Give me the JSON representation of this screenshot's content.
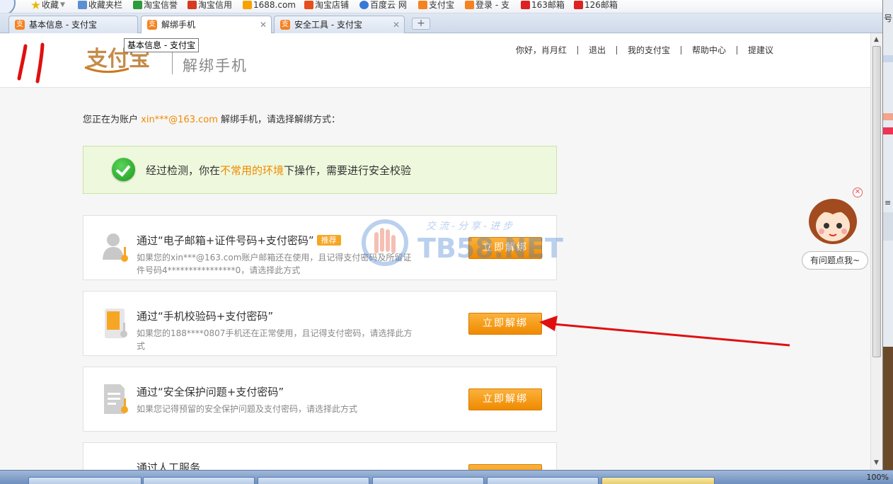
{
  "browser": {
    "bookmarks": [
      {
        "label": "收藏",
        "icon": "star-icon",
        "color": "#e8b800"
      },
      {
        "label": "收藏夹栏",
        "icon": "folder-icon",
        "color": "#5b8fd1"
      },
      {
        "label": "淘宝信誉",
        "icon": "search-icon",
        "color": "#2e9a3c"
      },
      {
        "label": "淘宝信用",
        "icon": "taobao-icon",
        "color": "#d63b1f"
      },
      {
        "label": "1688.com",
        "icon": "1688-icon",
        "color": "#f5a300"
      },
      {
        "label": "淘宝店铺",
        "icon": "store-icon",
        "color": "#e84d1c"
      },
      {
        "label": "百度云 网",
        "icon": "cloud-icon",
        "color": "#3779d8"
      },
      {
        "label": "支付宝",
        "icon": "alipay-icon",
        "color": "#f58220"
      },
      {
        "label": "登录 - 支",
        "icon": "alipay-icon",
        "color": "#f58220"
      },
      {
        "label": "163邮箱",
        "icon": "mail163-icon",
        "color": "#d22"
      },
      {
        "label": "126邮箱",
        "icon": "mail126-icon",
        "color": "#d22"
      }
    ],
    "tabs": [
      {
        "label": "基本信息 - 支付宝",
        "active": false
      },
      {
        "label": "解绑手机",
        "active": true
      },
      {
        "label": "安全工具 - 支付宝",
        "active": false
      }
    ],
    "new_tab": "+",
    "tooltip": "基本信息 - 支付宝",
    "side_fragments": [
      "号",
      "≡"
    ]
  },
  "header": {
    "logo_text": "支付宝",
    "page_title": "解绑手机",
    "nav": [
      "你好，肖月红",
      "退出",
      "我的支付宝",
      "帮助中心",
      "提建议"
    ]
  },
  "intro": {
    "prefix": "您正在为账户 ",
    "account": "xin***@163.com",
    "suffix": " 解绑手机，请选择解绑方式："
  },
  "alert": {
    "text_before": "经过检测，你在",
    "highlight": "不常用的环境",
    "text_after": "下操作，需要进行安全校验"
  },
  "options": [
    {
      "title": "通过“电子邮箱+证件号码+支付密码”",
      "tag": "推荐",
      "desc": "如果您的xin***@163.com账户邮箱还在使用，且记得支付密码及所留证件号码4****************0，请选择此方式",
      "button": "立即解绑",
      "icon": "id-person-icon"
    },
    {
      "title": "通过“手机校验码+支付密码”",
      "tag": "",
      "desc": "如果您的188****0807手机还在正常使用，且记得支付密码，请选择此方式",
      "button": "立即解绑",
      "icon": "phone-icon"
    },
    {
      "title": "通过“安全保护问题+支付密码”",
      "tag": "",
      "desc": "如果您记得预留的安全保护问题及支付密码，请选择此方式",
      "button": "立即解绑",
      "icon": "document-key-icon"
    },
    {
      "title": "通过人工服务",
      "tag": "",
      "desc": "",
      "button": "",
      "icon": "service-icon"
    }
  ],
  "watermark": {
    "text": "TB58.NET",
    "slogan": "交流-分享-进步"
  },
  "help_widget": {
    "label": "有问题点我~",
    "close": "✕"
  },
  "taskbar": {
    "tray_text": "100%"
  },
  "colors": {
    "accent_orange": "#f08a00",
    "button_orange": "#ef8a00",
    "alert_bg": "#eef8dc",
    "annotation_red": "#e01010"
  }
}
